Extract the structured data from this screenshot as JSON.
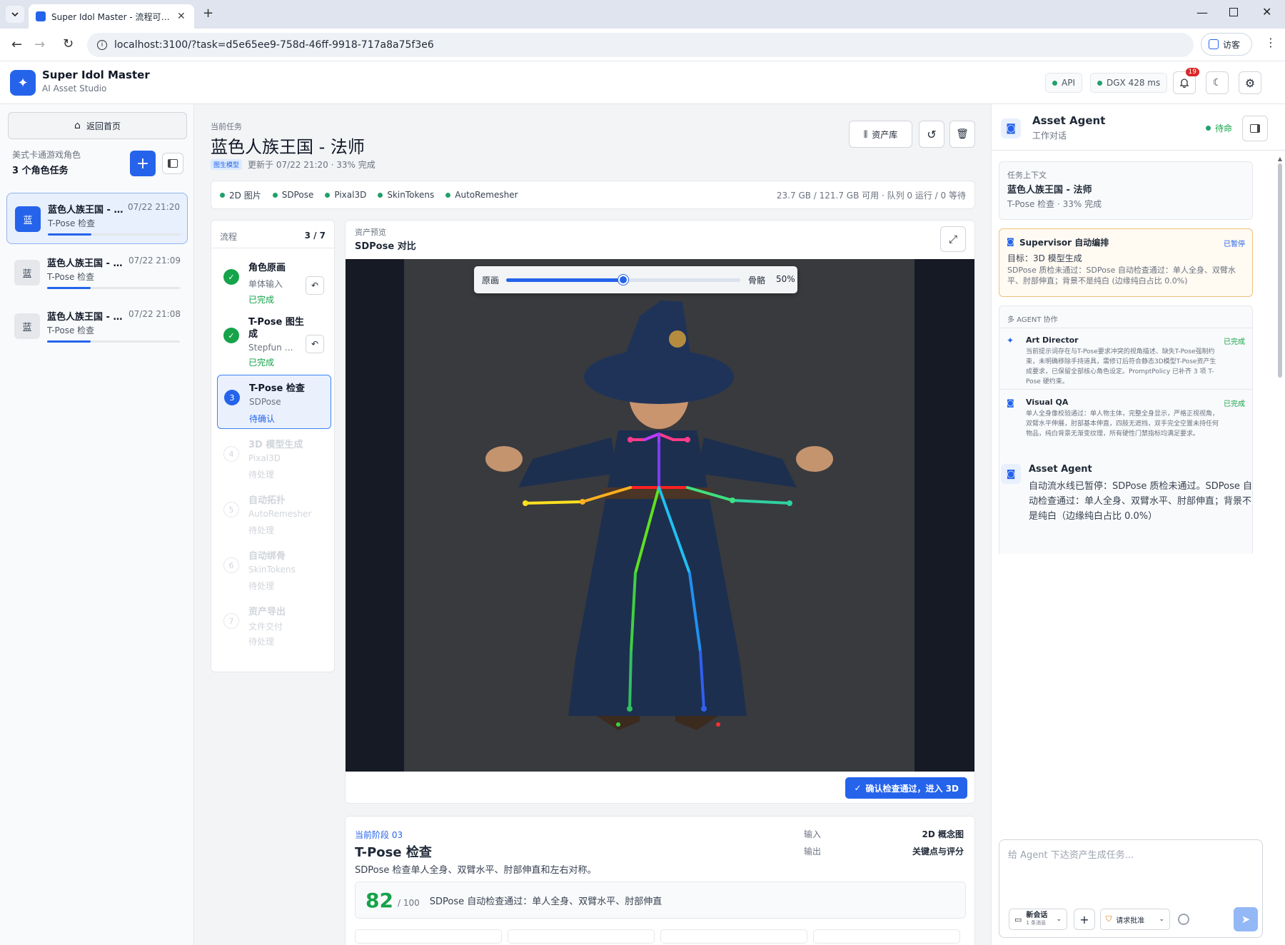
{
  "browser": {
    "tab_title": "Super Idol Master - 流程可视化",
    "url": "localhost:3100/?task=d5e65ee9-758d-46ff-9918-717a8a75f3e6",
    "profile_label": "访客"
  },
  "header": {
    "app_name": "Super Idol Master",
    "app_sub": "AI Asset Studio",
    "status_api": "API",
    "status_dgx": "DGX 428 ms",
    "notif_count": "19"
  },
  "sidebar": {
    "home_button": "返回首页",
    "group_label": "美式卡通游戏角色",
    "task_count": "3 个角色任务",
    "tasks": [
      {
        "avatar": "蓝",
        "title": "蓝色人族王国 - 法师",
        "time": "07/22 21:20",
        "stage": "T-Pose 检查",
        "progress": 0.33
      },
      {
        "avatar": "蓝",
        "title": "蓝色人族王国 - 法师",
        "time": "07/22 21:09",
        "stage": "T-Pose 检查",
        "progress": 0.33
      },
      {
        "avatar": "蓝",
        "title": "蓝色人族王国 - 法师",
        "time": "07/22 21:08",
        "stage": "T-Pose 检查",
        "progress": 0.33
      }
    ]
  },
  "task": {
    "eyebrow": "当前任务",
    "title": "蓝色人族王国 - 法师",
    "badge": "图生模型",
    "updated": "更新于 07/22 21:20 · 33% 完成",
    "assets_button": "资产库",
    "tools": [
      "2D 图片",
      "SDPose",
      "Pixal3D",
      "SkinTokens",
      "AutoRemesher"
    ],
    "resources": "23.7 GB / 121.7 GB 可用 · 队列 0 运行 / 0 等待"
  },
  "pipeline": {
    "label": "流程",
    "count": "3 / 7",
    "steps": [
      {
        "num": "1",
        "name": "角色原画",
        "sub": "单体输入",
        "status": "已完成"
      },
      {
        "num": "2",
        "name": "T-Pose 图生成",
        "sub": "Stepfun 图...",
        "status": "已完成"
      },
      {
        "num": "3",
        "name": "T-Pose 检查",
        "sub": "SDPose",
        "status": "待确认"
      },
      {
        "num": "4",
        "name": "3D 模型生成",
        "sub": "Pixal3D",
        "status": "待处理"
      },
      {
        "num": "5",
        "name": "自动拓扑",
        "sub": "AutoRemesher",
        "status": "待处理"
      },
      {
        "num": "6",
        "name": "自动绑骨",
        "sub": "SkinTokens",
        "status": "待处理"
      },
      {
        "num": "7",
        "name": "资产导出",
        "sub": "文件交付",
        "status": "待处理"
      }
    ]
  },
  "preview": {
    "eyebrow": "资产预览",
    "title": "SDPose 对比",
    "slider_left": "原画",
    "slider_right": "骨骼",
    "slider_value": "50%",
    "slider_fraction": 0.5,
    "confirm_button": "确认检查通过，进入 3D"
  },
  "stage": {
    "eyebrow": "当前阶段 03",
    "title": "T-Pose 检查",
    "desc": "SDPose 检查单人全身、双臂水平、肘部伸直和左右对称。",
    "input_label": "输入",
    "input_value": "2D 概念图",
    "output_label": "输出",
    "output_value": "关键点与评分",
    "score": "82",
    "score_max": "/ 100",
    "score_text": "SDPose 自动检查通过：单人全身、双臂水平、肘部伸直"
  },
  "agent": {
    "title": "Asset Agent",
    "sub": "工作对话",
    "status": "待命",
    "context_label": "任务上下文",
    "context_title": "蓝色人族王国 - 法师",
    "context_sub": "T-Pose 检查 · 33% 完成",
    "supervisor_title": "Supervisor 自动编排",
    "supervisor_status": "已暂停",
    "supervisor_goal": "目标：3D 模型生成",
    "supervisor_text": "SDPose 质检未通过：SDPose 自动检查通过：单人全身、双臂水平、肘部伸直；背景不是纯白 (边缘纯白占比 0.0%)",
    "collab_label": "多 AGENT 协作",
    "collab": [
      {
        "name": "Art Director",
        "status": "已完成",
        "text": "当前提示词存在与T-Pose要求冲突的视角描述、缺失T-Pose强制约束，未明确移除手持道具，需修订后符合静态3D模型T-Pose资产生成要求，已保留全部核心角色设定。PromptPolicy 已补齐 3 项 T-Pose 硬约束。"
      },
      {
        "name": "Visual QA",
        "status": "已完成",
        "text": "单人全身像校验通过：单人物主体，完整全身显示，严格正视视角，双臂水平伸展，肘部基本伸直，四肢无遮挡，双手完全空置未持任何物品，纯白背景无渐变纹理，所有硬性门禁指标均满足要求。"
      }
    ],
    "msg_name": "Asset Agent",
    "msg_text": "自动流水线已暂停：SDPose 质检未通过。SDPose 自动检查通过：单人全身、双臂水平、肘部伸直；背景不是纯白（边缘纯白占比 0.0%）",
    "input_placeholder": "给 Agent 下达资产生成任务...",
    "session_label": "新会话",
    "session_sub": "1 条消息",
    "approval_label": "请求批准"
  },
  "colors": {
    "accent": "#2563eb",
    "success": "#22a06b",
    "warning": "#d97706"
  }
}
